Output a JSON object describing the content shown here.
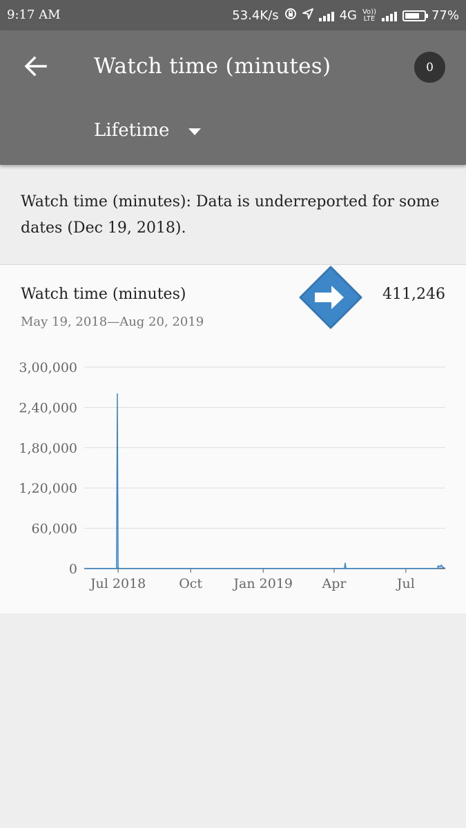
{
  "status_bar": {
    "time": "9:17 AM",
    "net_speed": "53.4K/s",
    "network": "4G",
    "volte_top": "Vo))",
    "volte_bottom": "LTE",
    "battery": "77%",
    "battery_level": 0.77
  },
  "header": {
    "title": "Watch time (minutes)",
    "badge_count": "0",
    "period": "Lifetime",
    "icons": {
      "back": "arrow-left-icon",
      "dropdown": "caret-down-icon"
    }
  },
  "notice": {
    "text": "Watch time (minutes): Data is underreported for some dates (Dec 19, 2018)."
  },
  "card": {
    "title": "Watch time (minutes)",
    "date_range": "May 19, 2018—Aug 20, 2019",
    "total": "411,246",
    "overlay_icon": "arrow-right-diamond-icon"
  },
  "colors": {
    "status_bar": "#5c5c5c",
    "app_bar": "#6f6f6f",
    "accent": "#3d87c9",
    "background": "#eeeeee",
    "card": "#fafafa"
  },
  "chart_data": {
    "type": "area",
    "ylim": [
      0,
      300000
    ],
    "yticks": [
      0,
      60000,
      120000,
      180000,
      240000,
      300000
    ],
    "ytick_labels": [
      "0",
      "60,000",
      "1,20,000",
      "1,80,000",
      "2,40,000",
      "3,00,000"
    ],
    "xlim": [
      "2018-05-19",
      "2019-08-20"
    ],
    "xtick_labels": [
      {
        "date": "2018-07-01",
        "label": "Jul 2018"
      },
      {
        "date": "2018-10-01",
        "label": "Oct"
      },
      {
        "date": "2019-01-01",
        "label": "Jan 2019"
      },
      {
        "date": "2019-04-01",
        "label": "Apr"
      },
      {
        "date": "2019-07-01",
        "label": "Jul"
      }
    ],
    "grid": true,
    "series": [
      {
        "points": [
          {
            "x": "2018-05-19",
            "y": 0
          },
          {
            "x": "2018-06-29",
            "y": 0
          },
          {
            "x": "2018-06-30",
            "y": 260000
          },
          {
            "x": "2018-07-01",
            "y": 2000
          },
          {
            "x": "2018-07-02",
            "y": 0
          },
          {
            "x": "2019-04-14",
            "y": 0
          },
          {
            "x": "2019-04-15",
            "y": 8000
          },
          {
            "x": "2019-04-16",
            "y": 0
          },
          {
            "x": "2019-08-10",
            "y": 0
          },
          {
            "x": "2019-08-11",
            "y": 4000
          },
          {
            "x": "2019-08-13",
            "y": 3000
          },
          {
            "x": "2019-08-15",
            "y": 5000
          },
          {
            "x": "2019-08-17",
            "y": 2000
          },
          {
            "x": "2019-08-20",
            "y": 0
          }
        ]
      }
    ]
  }
}
